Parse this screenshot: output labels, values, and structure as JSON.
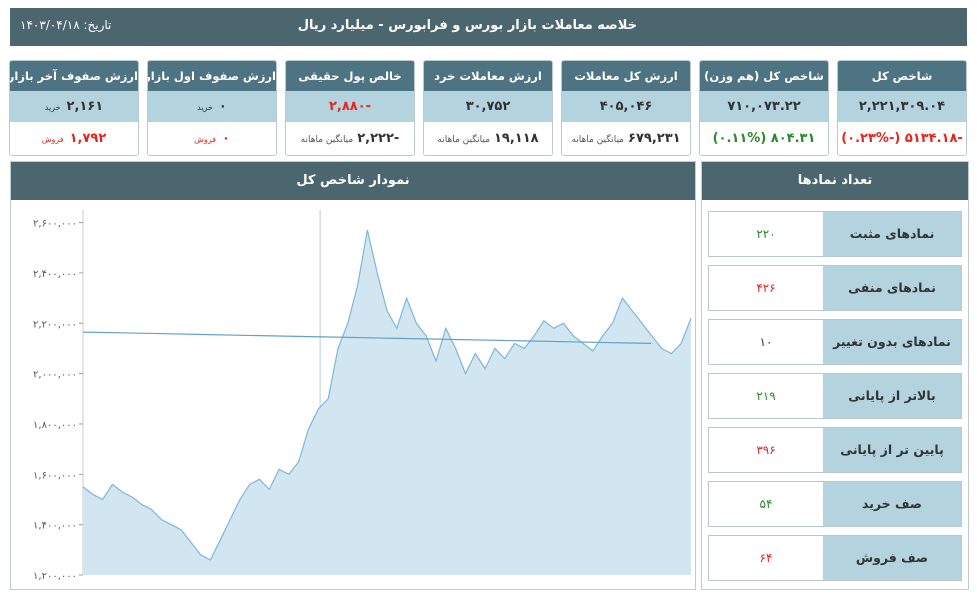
{
  "header": {
    "title": "خلاصه معاملات بازار بورس و فرابورس - میلیارد ریال",
    "date_label": "تاریخ: ۱۴۰۳/۰۴/۱۸"
  },
  "cards": [
    {
      "title": "شاخص کل",
      "value": "۲,۲۲۱,۳۰۹.۰۴",
      "sub": "-۵۱۳۴.۱۸ (-۰.۲۳%)",
      "sub_class": "neg"
    },
    {
      "title": "شاخص کل (هم وزن)",
      "value": "۷۱۰,۰۷۳.۲۲",
      "sub": "۸۰۴.۳۱ (۰.۱۱%)",
      "sub_class": "pos"
    },
    {
      "title": "ارزش کل معاملات",
      "value": "۴۰۵,۰۴۶",
      "sub_label": "میانگین ماهانه",
      "sub": "۶۷۹,۲۳۱",
      "sub_class": "plain"
    },
    {
      "title": "ارزش معاملات خرد",
      "value": "۳۰,۷۵۲",
      "sub_label": "میانگین ماهانه",
      "sub": "۱۹,۱۱۸",
      "sub_class": "plain"
    },
    {
      "title": "خالص پول حقیقی",
      "value": "-۲,۸۸۰",
      "value_class": "neg",
      "sub_label": "میانگین ماهانه",
      "sub": "-۲,۲۲۲",
      "sub_class": "plain"
    },
    {
      "title": "ارزش صفوف اول بازار",
      "buy_label": "خرید",
      "buy": "۰",
      "sell_label": "فروش",
      "sell": "۰"
    },
    {
      "title": "ارزش صفوف آخر بازار",
      "buy_label": "خرید",
      "buy": "۲,۱۶۱",
      "sell_label": "فروش",
      "sell": "۱,۷۹۲"
    }
  ],
  "chart_panel": {
    "title": "نمودار شاخص کل"
  },
  "chart_data": {
    "type": "area",
    "yticks": [
      "۲,۶۰۰,۰۰۰",
      "۲,۴۰۰,۰۰۰",
      "۲,۲۰۰,۰۰۰",
      "۲,۰۰۰,۰۰۰",
      "۱,۸۰۰,۰۰۰",
      "۱,۶۰۰,۰۰۰",
      "۱,۴۰۰,۰۰۰",
      "۱,۲۰۰,۰۰۰"
    ],
    "ylim": [
      1200000,
      2650000
    ],
    "grid": false,
    "values": [
      1550000,
      1520000,
      1500000,
      1560000,
      1530000,
      1510000,
      1480000,
      1460000,
      1420000,
      1400000,
      1380000,
      1330000,
      1280000,
      1260000,
      1340000,
      1420000,
      1500000,
      1560000,
      1580000,
      1540000,
      1620000,
      1600000,
      1650000,
      1780000,
      1860000,
      1900000,
      2100000,
      2200000,
      2350000,
      2570000,
      2400000,
      2250000,
      2180000,
      2300000,
      2200000,
      2150000,
      2050000,
      2180000,
      2100000,
      2000000,
      2080000,
      2020000,
      2100000,
      2060000,
      2120000,
      2100000,
      2150000,
      2210000,
      2180000,
      2200000,
      2150000,
      2120000,
      2090000,
      2150000,
      2200000,
      2300000,
      2250000,
      2200000,
      2150000,
      2100000,
      2080000,
      2120000,
      2220000
    ],
    "trend_values": [
      2165000,
      2160000,
      2155000,
      2150000,
      2145000,
      2140000,
      2135000,
      2130000,
      2125000,
      2120000
    ],
    "gap_index": 26
  },
  "counts_panel": {
    "title": "تعداد نمادها",
    "rows": [
      {
        "label": "نمادهای مثبت",
        "value": "۲۲۰",
        "color": "#2a8a2a"
      },
      {
        "label": "نمادهای منفی",
        "value": "۴۲۶",
        "color": "#e8241c"
      },
      {
        "label": "نمادهای بدون تغییر",
        "value": "۱۰",
        "color": "#333333"
      },
      {
        "label": "بالاتر از پایانی",
        "value": "۲۱۹",
        "color": "#2a8a2a"
      },
      {
        "label": "پایین تر از پایانی",
        "value": "۳۹۶",
        "color": "#e8241c"
      },
      {
        "label": "صف خرید",
        "value": "۵۴",
        "color": "#2a8a2a"
      },
      {
        "label": "صف فروش",
        "value": "۶۴",
        "color": "#e8241c"
      }
    ]
  }
}
